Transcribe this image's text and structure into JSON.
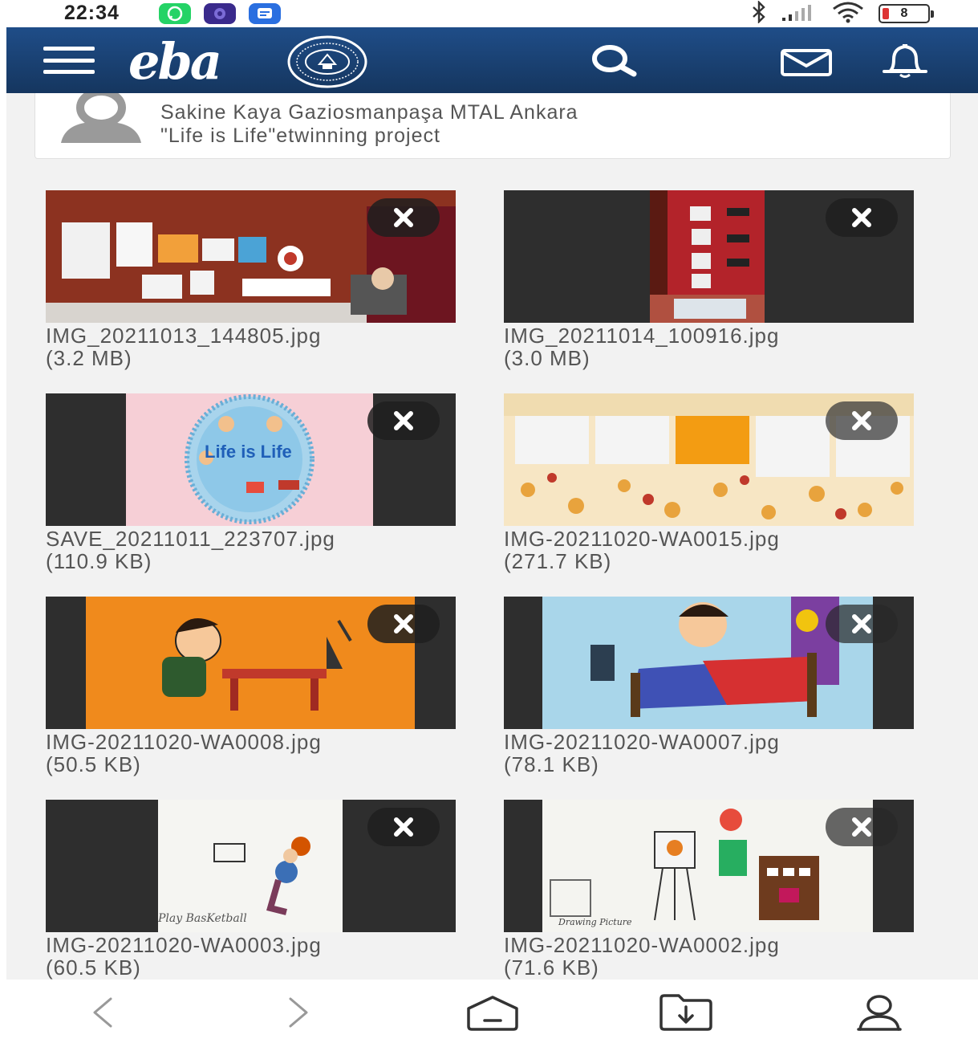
{
  "status_bar": {
    "time": "22:34",
    "app_icons": [
      {
        "name": "whatsapp-icon",
        "color": "#25d366"
      },
      {
        "name": "app-icon",
        "color": "#3a2a8c"
      },
      {
        "name": "messages-icon",
        "color": "#2a6fe0"
      }
    ],
    "battery_level": "8",
    "right_icons": [
      "bluetooth-icon",
      "signal-icon",
      "wifi-icon",
      "battery-icon"
    ]
  },
  "header": {
    "logo_text": "eba",
    "seal_icon": "ministry-seal-icon",
    "icons": [
      "menu-icon",
      "search-icon",
      "mail-icon",
      "bell-icon"
    ],
    "background_color": "#1c4680"
  },
  "post": {
    "line1": "Sakine Kaya Gaziosmanpaşa MTAL Ankara",
    "line2": "\"Life is Life\"etwinning project"
  },
  "attachments": [
    {
      "filename": "IMG_20211013_144805.jpg",
      "size": "(3.2 MB)",
      "thumb": "etwinning-board-photo"
    },
    {
      "filename": "IMG_20211014_100916.jpg",
      "size": "(3.0 MB)",
      "thumb": "red-board-photo"
    },
    {
      "filename": "SAVE_20211011_223707.jpg",
      "size": "(110.9 KB)",
      "thumb": "life-is-life-logo",
      "thumb_text": "Life is Life"
    },
    {
      "filename": "IMG-20211020-WA0015.jpg",
      "size": "(271.7 KB)",
      "thumb": "autumn-padlet-screenshot"
    },
    {
      "filename": "IMG-20211020-WA0008.jpg",
      "size": "(50.5 KB)",
      "thumb": "study-drawing"
    },
    {
      "filename": "IMG-20211020-WA0007.jpg",
      "size": "(78.1 KB)",
      "thumb": "wake-up-drawing"
    },
    {
      "filename": "IMG-20211020-WA0003.jpg",
      "size": "(60.5 KB)",
      "thumb": "basketball-drawing",
      "thumb_text": "Play BasKetball"
    },
    {
      "filename": "IMG-20211020-WA0002.jpg",
      "size": "(71.6 KB)",
      "thumb": "painting-drawing",
      "thumb_text": "Drawing Picture"
    }
  ],
  "bottom_nav": [
    "back-icon",
    "forward-icon",
    "home-icon",
    "downloads-icon",
    "profile-icon"
  ]
}
